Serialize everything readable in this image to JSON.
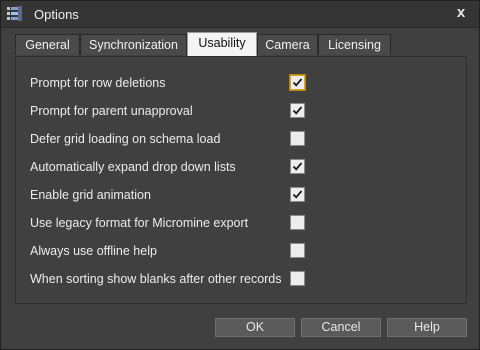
{
  "window": {
    "title": "Options",
    "close_glyph": "x",
    "icon": "options-app-icon"
  },
  "tabs": [
    {
      "label": "General",
      "active": false
    },
    {
      "label": "Synchronization",
      "active": false
    },
    {
      "label": "Usability",
      "active": true
    },
    {
      "label": "Camera",
      "active": false
    },
    {
      "label": "Licensing",
      "active": false
    }
  ],
  "options": [
    {
      "label": "Prompt for row deletions",
      "checked": true,
      "focused": true
    },
    {
      "label": "Prompt for parent unapproval",
      "checked": true,
      "focused": false
    },
    {
      "label": "Defer grid loading on schema load",
      "checked": false,
      "focused": false
    },
    {
      "label": "Automatically expand drop down lists",
      "checked": true,
      "focused": false
    },
    {
      "label": "Enable grid animation",
      "checked": true,
      "focused": false
    },
    {
      "label": "Use legacy format for Micromine export",
      "checked": false,
      "focused": false
    },
    {
      "label": "Always use offline help",
      "checked": false,
      "focused": false
    },
    {
      "label": "When sorting show blanks after other records",
      "checked": false,
      "focused": false
    }
  ],
  "buttons": {
    "ok": "OK",
    "cancel": "Cancel",
    "help": "Help"
  },
  "colors": {
    "background": "#404040",
    "focus_accent": "#d6a520",
    "active_tab": "#f4f4f4"
  }
}
